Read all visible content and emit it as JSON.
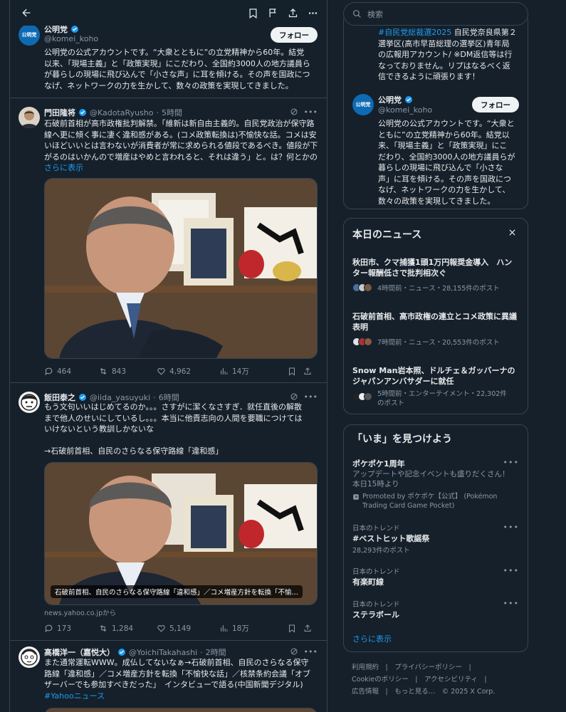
{
  "topbar": {
    "back_icon": "arrow-left-icon",
    "icons": [
      "bookmark-icon",
      "flag-icon",
      "share-icon",
      "more-icon"
    ]
  },
  "profile_card": {
    "name": "公明党",
    "handle": "@komei_koho",
    "follow_label": "フォロー",
    "bio_lines": [
      "公明党の公式アカウントです。“大衆とともに”の立党精神から60年。結党",
      "以来、「現場主義」と「政策実現」にこだわり、全国約3000人の地方議員ら",
      "が暮らしの現場に飛び込んで「小さな声」に耳を傾ける。その声を国政につ",
      "なげ、ネットワークの力を生かして、数々の政策を実現してきました。"
    ]
  },
  "tweets": [
    {
      "name": "門田隆将",
      "handle": "@KadotaRyusho",
      "time": "5時間",
      "lines": [
        "石破前首相が高市政権批判解禁。「維新は新自由主義的。自民党政治が保守路",
        "線へ更に傾く事に凄く違和感がある。(コメ政策転換は)不愉快な話。コメは安",
        "いほどいいとは言わないが消費者が常に求められる値段であるべき。値段が下",
        "がるのはいかんので増産はやめと言われると、それは違う」と。は？何とかの"
      ],
      "show_more": "さらに表示",
      "replies": "464",
      "retweets": "843",
      "likes": "4,962",
      "views": "14万"
    },
    {
      "name": "飯田泰之",
      "handle": "@iida_yasuyuki",
      "time": "6時間",
      "lines": [
        "もう文句いいはじめてるのか。。。さすがに潔くなさすぎ．就任直後の解散",
        "まで他人のせいにしているし。。。本当に他責志向の人間を要職につけては",
        "いけないという教訓しかないな",
        "",
        "→石破前首相、自民のさらなる保守路線「違和感」"
      ],
      "card_caption": "石破前首相、自民のさらなる保守路線「違和感」／コメ増産方針を転換「不愉…",
      "card_domain": "news.yahoo.co.jpから",
      "replies": "173",
      "retweets": "1,284",
      "likes": "5,149",
      "views": "18万"
    },
    {
      "name": "高橋洋一（嘉悦大）",
      "handle": "@YoichiTakahashi",
      "time": "2時間",
      "lines": [
        "また通常運転WWW。成仏してないなぁ→石破前首相、自民のさらなる保守",
        "路線「違和感」／コメ増産方針を転換「不愉快な話」／核禁条約会議「オブ",
        "ザーバーでも参加すべきだった」　インタビューで語る(中国新聞デジタル)"
      ],
      "hashtag": "#Yahooニュース"
    }
  ],
  "search": {
    "placeholder": "検索",
    "icon": "search-icon"
  },
  "right_bio": {
    "top_lines": [
      "#自民党総裁選2025 自民党奈良県第２",
      "選挙区(高市早苗総理の選挙区)青年局",
      "の広報用アカウント/ ※DM返信等は行",
      "なっておりません。リプはなるべく返",
      "信できるように頑張ります！"
    ],
    "top_hashtag": "#自民党総裁選2025",
    "name": "公明党",
    "handle": "@komei_koho",
    "follow_label": "フォロー",
    "bio_lines": [
      "公明党の公式アカウントです。“大衆と",
      "ともに”の立党精神から60年。結党以",
      "来、「現場主義」と「政策実現」にこ",
      "だわり、全国約3000人の地方議員らが",
      "暮らしの現場に飛び込んで「小さな",
      "声」に耳を傾ける。その声を国政につ",
      "なげ、ネットワークの力を生かして、",
      "数々の政策を実現してきました。"
    ]
  },
  "news": {
    "title": "本日のニュース",
    "items": [
      {
        "title_lines": [
          "秋田市、クマ捕獲1頭1万円報奨金導入　ハン",
          "ター報酬低さで批判相次ぐ"
        ],
        "meta": "4時間前・ニュース・28,155件のポスト"
      },
      {
        "title_lines": [
          "石破前首相、高市政権の連立とコメ政策に異議",
          "表明"
        ],
        "meta": "7時間前・ニュース・20,553件のポスト"
      },
      {
        "title_lines": [
          "Snow Man岩本照、ドルチェ＆ガッバーナの",
          "ジャパンアンバサダーに就任"
        ],
        "meta_lines": [
          "5時間前・エンターテイメント・22,302件",
          "のポスト"
        ]
      }
    ]
  },
  "trends": {
    "title": "「いま」を見つけよう",
    "promo": {
      "name": "ポケポケ1周年",
      "lines": [
        "アップデートや記念イベントも盛りだくさん！",
        "本日15時より"
      ],
      "promoted_lines": [
        "Promoted by ポケポケ【公式】 (Pokémon",
        "Trading Card Game Pocket)"
      ]
    },
    "items": [
      {
        "category": "日本のトレンド",
        "name": "#ベストヒット歌謡祭",
        "posts": "28,293件のポスト"
      },
      {
        "category": "日本のトレンド",
        "name": "有楽町線"
      },
      {
        "category": "日本のトレンド",
        "name": "ステラボール"
      }
    ],
    "show_more": "さらに表示"
  },
  "footer": {
    "row1": "利用規約　|　プライバシーポリシー　|",
    "row2": "Cookieのポリシー　|　アクセシビリティ　|",
    "row3": "広告情報　|　もっと見る…　© 2025 X Corp."
  }
}
